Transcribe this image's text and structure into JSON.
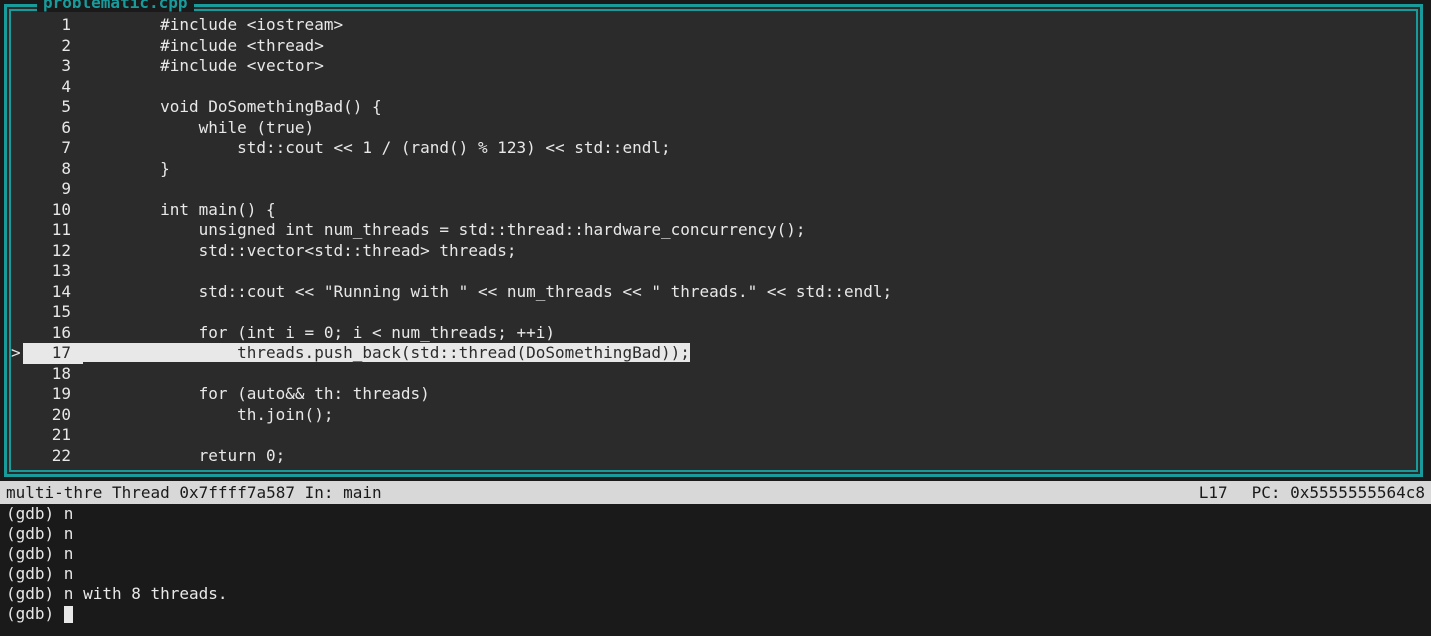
{
  "source_panel": {
    "title": "problematic.cpp",
    "current_line": 17,
    "lines": [
      {
        "num": 1,
        "marker": " ",
        "text": "        #include <iostream>"
      },
      {
        "num": 2,
        "marker": " ",
        "text": "        #include <thread>"
      },
      {
        "num": 3,
        "marker": " ",
        "text": "        #include <vector>"
      },
      {
        "num": 4,
        "marker": " ",
        "text": ""
      },
      {
        "num": 5,
        "marker": " ",
        "text": "        void DoSomethingBad() {"
      },
      {
        "num": 6,
        "marker": " ",
        "text": "            while (true)"
      },
      {
        "num": 7,
        "marker": " ",
        "text": "                std::cout << 1 / (rand() % 123) << std::endl;"
      },
      {
        "num": 8,
        "marker": " ",
        "text": "        }"
      },
      {
        "num": 9,
        "marker": " ",
        "text": ""
      },
      {
        "num": 10,
        "marker": " ",
        "text": "        int main() {"
      },
      {
        "num": 11,
        "marker": " ",
        "text": "            unsigned int num_threads = std::thread::hardware_concurrency();"
      },
      {
        "num": 12,
        "marker": " ",
        "text": "            std::vector<std::thread> threads;"
      },
      {
        "num": 13,
        "marker": " ",
        "text": ""
      },
      {
        "num": 14,
        "marker": " ",
        "text": "            std::cout << \"Running with \" << num_threads << \" threads.\" << std::endl;"
      },
      {
        "num": 15,
        "marker": " ",
        "text": ""
      },
      {
        "num": 16,
        "marker": " ",
        "text": "            for (int i = 0; i < num_threads; ++i)"
      },
      {
        "num": 17,
        "marker": ">",
        "text": "                threads.push_back(std::thread(DoSomethingBad));"
      },
      {
        "num": 18,
        "marker": " ",
        "text": ""
      },
      {
        "num": 19,
        "marker": " ",
        "text": "            for (auto&& th: threads)"
      },
      {
        "num": 20,
        "marker": " ",
        "text": "                th.join();"
      },
      {
        "num": 21,
        "marker": " ",
        "text": ""
      },
      {
        "num": 22,
        "marker": " ",
        "text": "            return 0;"
      }
    ]
  },
  "status_bar": {
    "left": "multi-thre Thread 0x7ffff7a587 In: main",
    "line_label": "L17",
    "pc_label": "PC: 0x5555555564c8"
  },
  "console": {
    "lines": [
      "(gdb) n",
      "(gdb) n",
      "(gdb) n",
      "(gdb) n",
      "(gdb) n with 8 threads.",
      "(gdb) "
    ]
  }
}
